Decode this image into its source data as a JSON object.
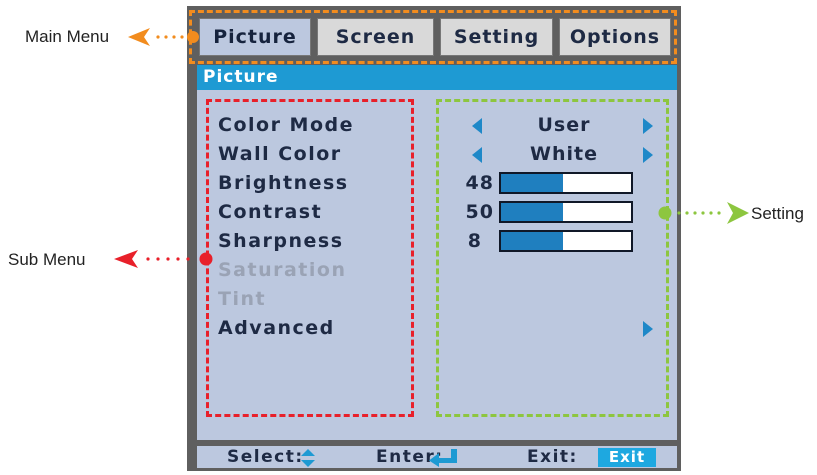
{
  "callouts": {
    "main_menu": "Main Menu",
    "sub_menu": "Sub Menu",
    "setting": "Setting"
  },
  "tabs": [
    {
      "label": "Picture",
      "active": true
    },
    {
      "label": "Screen",
      "active": false
    },
    {
      "label": "Setting",
      "active": false
    },
    {
      "label": "Options",
      "active": false
    }
  ],
  "section_title": "Picture",
  "submenu": [
    {
      "label": "Color Mode",
      "enabled": true
    },
    {
      "label": "Wall Color",
      "enabled": true
    },
    {
      "label": "Brightness",
      "enabled": true
    },
    {
      "label": "Contrast",
      "enabled": true
    },
    {
      "label": "Sharpness",
      "enabled": true
    },
    {
      "label": "Saturation",
      "enabled": false
    },
    {
      "label": "Tint",
      "enabled": false
    },
    {
      "label": "Advanced",
      "enabled": true
    }
  ],
  "settings": {
    "color_mode": "User",
    "wall_color": "White",
    "brightness": {
      "value": "48",
      "fill_fraction": 0.48
    },
    "contrast": {
      "value": "50",
      "fill_fraction": 0.48
    },
    "sharpness": {
      "value": "8",
      "fill_fraction": 0.48
    }
  },
  "footer": {
    "select": "Select:",
    "enter": "Enter:",
    "exit": "Exit:",
    "exit_key": "Exit"
  },
  "colors": {
    "accent_blue": "#1e9ad3",
    "main_menu_marker": "#f28c1e",
    "sub_menu_marker": "#e8202a",
    "setting_marker": "#8dc63f"
  }
}
